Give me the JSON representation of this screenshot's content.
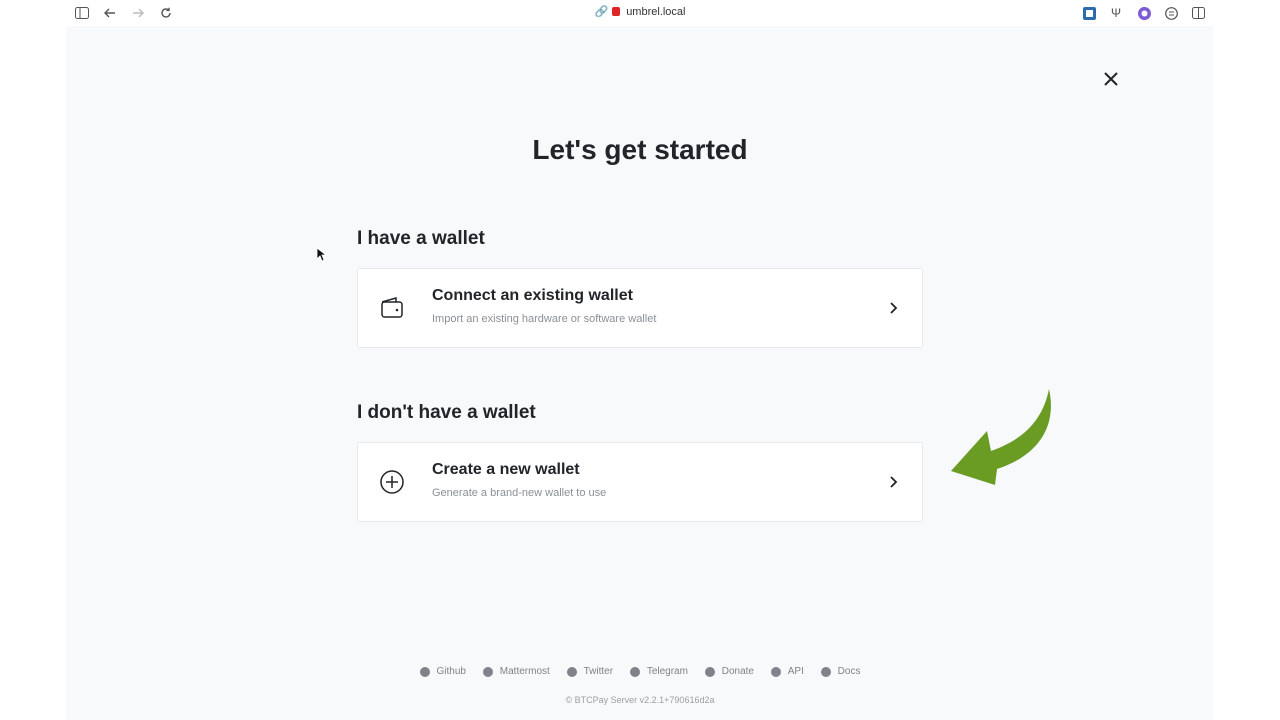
{
  "browser": {
    "url": "umbrel.local",
    "icons": [
      "sidebar-icon",
      "back-icon",
      "forward-icon",
      "reload-icon",
      "link-icon",
      "extension-icon",
      "psi-icon",
      "extension2-icon",
      "reader-icon",
      "split-view-icon"
    ]
  },
  "page": {
    "title": "Let's get started",
    "sections": [
      {
        "heading": "I have a wallet",
        "card": {
          "title": "Connect an existing wallet",
          "description": "Import an existing hardware or software wallet",
          "icon": "wallet-icon"
        }
      },
      {
        "heading": "I don't have a wallet",
        "card": {
          "title": "Create a new wallet",
          "description": "Generate a brand-new wallet to use",
          "icon": "plus-circle-icon"
        }
      }
    ],
    "accent_arrow_color": "#6a9b23"
  },
  "footer": {
    "links": [
      "Github",
      "Mattermost",
      "Twitter",
      "Telegram",
      "Donate",
      "API",
      "Docs"
    ],
    "copyright": "© BTCPay Server v2.2.1+790616d2a"
  }
}
